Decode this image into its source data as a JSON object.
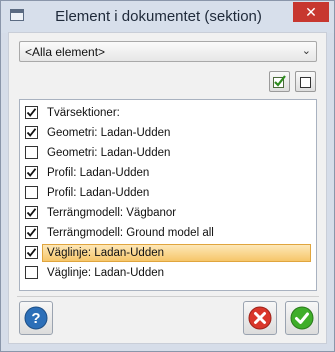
{
  "window": {
    "title": "Element i dokumentet (sektion)",
    "close_glyph": "✕"
  },
  "filter": {
    "selected": "<Alla element>"
  },
  "toolbar": {
    "check_all_icon": "check-all-icon",
    "uncheck_all_icon": "uncheck-all-icon"
  },
  "list": {
    "items": [
      {
        "label": "Tvärsektioner:",
        "checked": true,
        "selected": false
      },
      {
        "label": "Geometri: Ladan-Udden",
        "checked": true,
        "selected": false
      },
      {
        "label": "Geometri: Ladan-Udden",
        "checked": false,
        "selected": false
      },
      {
        "label": "Profil: Ladan-Udden",
        "checked": true,
        "selected": false
      },
      {
        "label": "Profil: Ladan-Udden",
        "checked": false,
        "selected": false
      },
      {
        "label": "Terrängmodell: Vägbanor",
        "checked": true,
        "selected": false
      },
      {
        "label": "Terrängmodell: Ground model all",
        "checked": true,
        "selected": false
      },
      {
        "label": "Väglinje: Ladan-Udden",
        "checked": true,
        "selected": true
      },
      {
        "label": "Väglinje: Ladan-Udden",
        "checked": false,
        "selected": false
      }
    ]
  },
  "buttons": {
    "help_icon": "help-icon",
    "cancel_icon": "cancel-icon",
    "ok_icon": "ok-icon"
  },
  "colors": {
    "accent_selection": "#f6c66a",
    "cancel_red": "#d9372b",
    "ok_green": "#3fae2a",
    "help_blue": "#2c6fb8"
  }
}
